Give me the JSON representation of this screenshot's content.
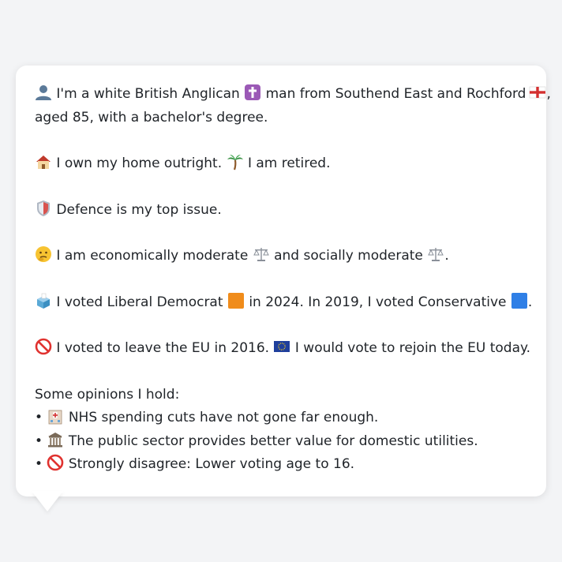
{
  "profile": {
    "line1_a": "I'm a white British Anglican",
    "line1_b": "man from Southend East and Rochford",
    "line1_c": ",",
    "line2": "aged 85, with a bachelor's degree.",
    "home_a": "I own my home outright.",
    "home_b": "I am retired.",
    "issue": "Defence is my top issue.",
    "econ_a": "I am economically moderate",
    "econ_b": "and socially moderate",
    "econ_c": ".",
    "vote_a": "I voted Liberal Democrat",
    "vote_b": "in 2024. In 2019, I voted Conservative",
    "vote_c": ".",
    "eu_a": "I voted to leave the EU in 2016.",
    "eu_b": "I would vote to rejoin the EU today."
  },
  "opinions": {
    "heading": "Some opinions I hold:",
    "bullet": "•",
    "items": [
      {
        "icon": "hospital-icon",
        "text": "NHS spending cuts have not gone far enough."
      },
      {
        "icon": "classical-building-icon",
        "text": "The public sector provides better value for domestic utilities."
      },
      {
        "icon": "prohibited-icon",
        "text": "Strongly disagree: Lower voting age to 16."
      }
    ]
  },
  "colors": {
    "background": "#f3f4f6",
    "bubble": "#ffffff",
    "text": "#1f2328",
    "libdem": "#f08c1b",
    "conservative": "#2f7fe6"
  }
}
